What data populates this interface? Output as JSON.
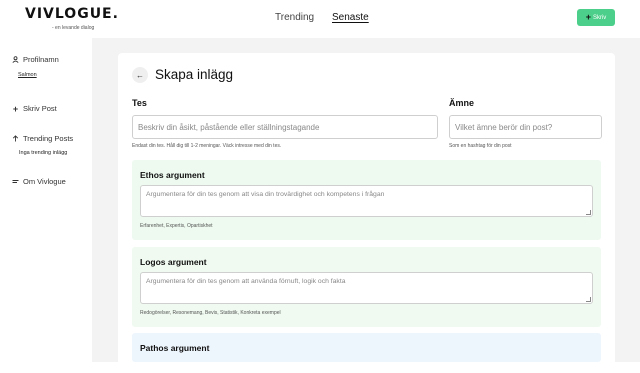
{
  "header": {
    "logo": "VIVLOGUE.",
    "tagline": "- en levande dialog",
    "nav": {
      "trending": "Trending",
      "senaste": "Senaste"
    },
    "write_button": "Skriv"
  },
  "sidebar": {
    "profile_label": "Profilnamn",
    "profile_user": "Salmon",
    "write_post": "Skriv Post",
    "trending_posts": "Trending Posts",
    "trending_empty": "Inga trending inlägg",
    "about": "Om Vivlogue"
  },
  "main": {
    "title": "Skapa inlägg",
    "tes": {
      "label": "Tes",
      "placeholder": "Beskriv din åsikt, påstående eller ställningstagande",
      "hint": "Endast din tes. Håll dig till 1-2 meningar. Väck intresse med din tes."
    },
    "amne": {
      "label": "Ämne",
      "placeholder": "Vilket ämne berör din post?",
      "hint": "Som en hashtag för din post"
    },
    "ethos": {
      "title": "Ethos argument",
      "placeholder": "Argumentera för din tes genom att visa din trovärdighet och kompetens i frågan",
      "hint": "Erfarenhet, Expertis, Opartiskhet"
    },
    "logos": {
      "title": "Logos argument",
      "placeholder": "Argumentera för din tes genom att använda förnuft, logik och fakta",
      "hint": "Redogörelser, Resonemang, Bevis, Statistik, Konkreta exempel"
    },
    "pathos": {
      "title": "Pathos argument"
    }
  },
  "colors": {
    "accent_button": "#4ccf8a",
    "ethos_bg": "#eefaf0",
    "logos_bg": "#f0faf1",
    "pathos_bg": "#eef6fd"
  }
}
